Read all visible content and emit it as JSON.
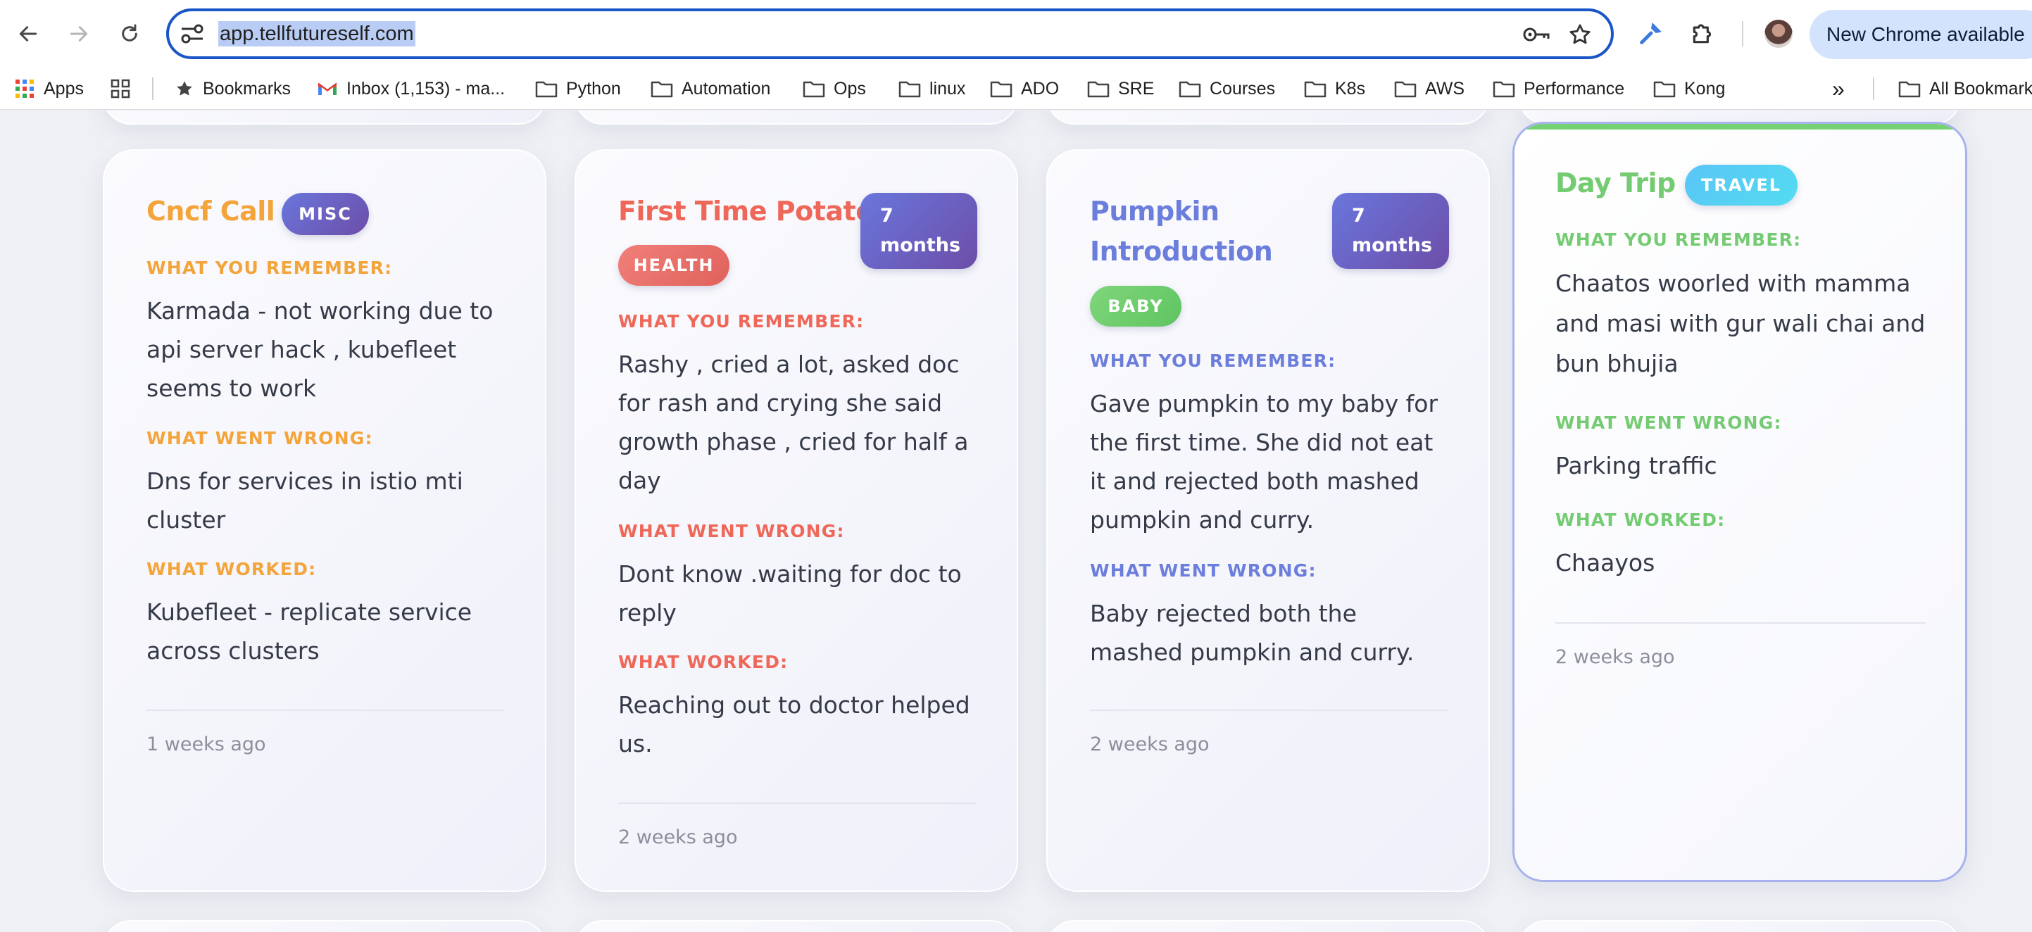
{
  "browser": {
    "url": "app.tellfutureself.com",
    "update_label": "New Chrome available"
  },
  "bookmarks": {
    "apps": "Apps",
    "items": [
      "Bookmarks",
      "Inbox (1,153) - ma...",
      "Python",
      "Automation",
      "Ops",
      "linux",
      "ADO",
      "SRE",
      "Courses",
      "K8s",
      "AWS",
      "Performance",
      "Kong"
    ],
    "more": "»",
    "all": "All Bookmarks"
  },
  "labels": {
    "remember": "WHAT YOU REMEMBER:",
    "wrong": "WHAT WENT WRONG:",
    "worked": "WHAT WORKED:"
  },
  "cards": [
    {
      "title": "Cncf Call",
      "category": "MISC",
      "remember": "Karmada - not working due to api server hack , kubefleet seems to work",
      "wrong": "Dns for services in istio mti cluster",
      "worked": "Kubefleet - replicate service across clusters",
      "ago": "1 weeks ago"
    },
    {
      "title": "First Time Potato",
      "age_line1": "7",
      "age_line2": "months",
      "category": "HEALTH",
      "remember": "Rashy , cried a lot, asked doc for rash and crying she said growth phase , cried for half a day",
      "wrong": "Dont know .waiting for doc to reply",
      "worked": "Reaching out to doctor helped us.",
      "ago": "2 weeks ago"
    },
    {
      "title": "Pumpkin Introduction",
      "age_line1": "7",
      "age_line2": "months",
      "category": "BABY",
      "remember": "Gave pumpkin to my baby for the first time. She did not eat it and rejected both mashed pumpkin and curry.",
      "wrong": "Baby rejected both the mashed pumpkin and curry.",
      "ago": "2 weeks ago"
    },
    {
      "title": "Day Trip",
      "category": "TRAVEL",
      "remember": "Chaatos woorled with mamma and masi with gur wali chai and bun bhujia",
      "wrong": "Parking traffic",
      "worked": "Chaayos",
      "ago": "2 weeks ago"
    }
  ],
  "colors": {
    "misc": "#f3a43a",
    "health": "#ee6758",
    "baby": "#6c7edc",
    "travel": "#74cb72"
  }
}
